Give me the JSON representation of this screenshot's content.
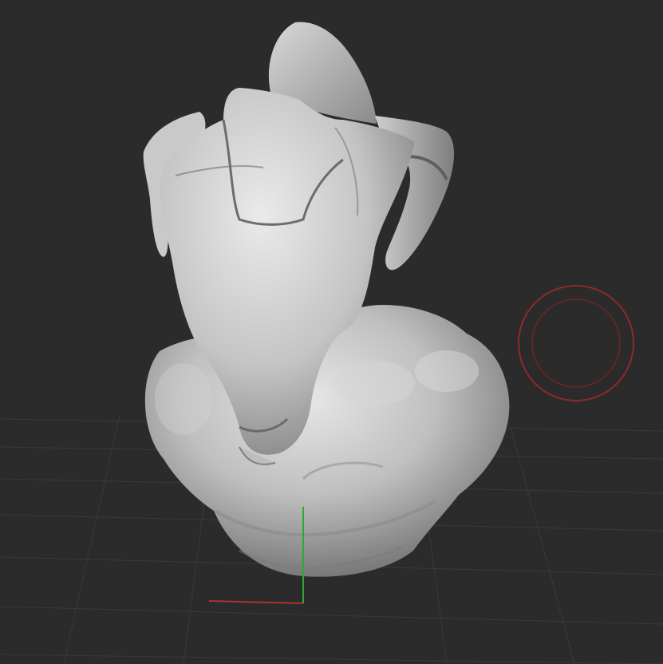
{
  "viewport": {
    "background_color": "#2b2b2b",
    "grid_color": "#3a3a3a",
    "grid_visible": true
  },
  "axes": {
    "x_axis_color": "#b03030",
    "y_axis_color": "#2fa83a"
  },
  "brush_cursor": {
    "color": "#8e2a2a",
    "icon": "brush-radius-cursor"
  },
  "model": {
    "base_color": "#bdbdbd",
    "shadow_color": "#6a6a6a",
    "highlight_color": "#e8e8e8"
  }
}
